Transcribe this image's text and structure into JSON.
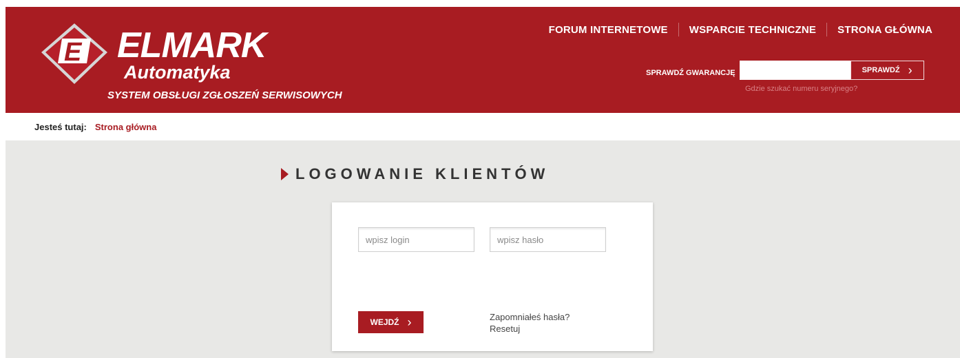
{
  "header": {
    "brand_name": "ELMARK",
    "brand_sub": "Automatyka",
    "logo_letter": "E",
    "system_title": "SYSTEM OBSŁUGI ZGŁOSZEŃ SERWISOWYCH",
    "nav": [
      {
        "label": "FORUM INTERNETOWE"
      },
      {
        "label": "WSPARCIE TECHNICZNE"
      },
      {
        "label": "STRONA GŁÓWNA"
      }
    ],
    "warranty": {
      "label": "SPRAWDŹ GWARANCJĘ",
      "input_value": "",
      "button_label": "SPRAWDŹ",
      "help_link": "Gdzie szukać numeru seryjnego?"
    }
  },
  "breadcrumb": {
    "label": "Jesteś tutaj:",
    "current": "Strona główna"
  },
  "main": {
    "heading": "LOGOWANIE KLIENTÓW",
    "login_form": {
      "login_placeholder": "wpisz login",
      "password_placeholder": "wpisz hasło",
      "submit_label": "WEJDŹ",
      "forgot_text": "Zapomniałeś hasła?",
      "reset_link": "Resetuj"
    }
  },
  "icons": {
    "logo": "elmark-logo-icon",
    "heading_marker": "triangle-right-icon",
    "chevron": "chevron-right-icon"
  },
  "colors": {
    "brand_red": "#a81c22",
    "content_bg": "#e8e8e6",
    "help_link": "#d98085"
  }
}
